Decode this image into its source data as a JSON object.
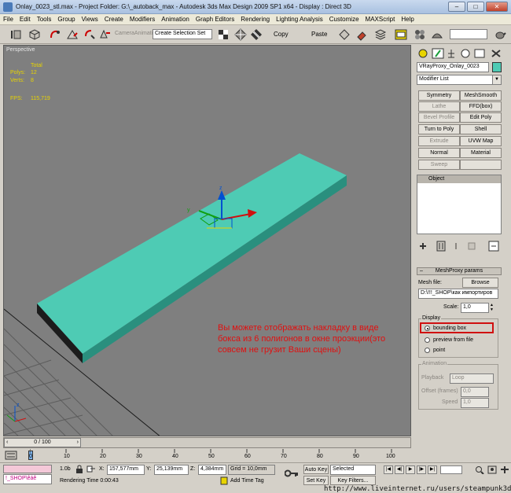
{
  "window": {
    "title": "Onlay_0023_stl.max    - Project Folder: G:\\_autoback_max    - Autodesk 3ds Max Design 2009 SP1  x64      - Display : Direct 3D",
    "minimize": "–",
    "maximize": "□",
    "close": "✕"
  },
  "menu": [
    "File",
    "Edit",
    "Tools",
    "Group",
    "Views",
    "Create",
    "Modifiers",
    "Animation",
    "Graph Editors",
    "Rendering",
    "Lighting Analysis",
    "Customize",
    "MAXScript",
    "Help"
  ],
  "toolbar": {
    "camera_label": "CameraAnimati",
    "selection_set": "Create Selection Set",
    "copy": "Copy",
    "paste": "Paste"
  },
  "viewport": {
    "label": "Perspective",
    "stats": {
      "total_label": "Total",
      "polys_label": "Polys:",
      "polys_value": "12",
      "verts_label": "Verts:",
      "verts_value": "8",
      "fps_label": "FPS:",
      "fps_value": "115,719"
    },
    "annotation": "Вы можете отображать накладку в виде бокса из 6 полигонов в окне проэкции(это совсем не грузит Ваши сцены)",
    "colors": {
      "object": "#4ecbb4",
      "background": "#7f7f7f",
      "annotation": "#e01010"
    }
  },
  "command_panel": {
    "object_name": "VRayProxy_Onlay_0023",
    "object_color": "#4ecbb4",
    "modifier_list": "Modifier List",
    "modifier_buttons": [
      {
        "label": "Symmetry",
        "enabled": true
      },
      {
        "label": "MeshSmooth",
        "enabled": true
      },
      {
        "label": "Lathe",
        "enabled": false
      },
      {
        "label": "FFD(box)",
        "enabled": true
      },
      {
        "label": "Bevel Profile",
        "enabled": false
      },
      {
        "label": "Edit Poly",
        "enabled": true
      },
      {
        "label": "Turn to Poly",
        "enabled": true
      },
      {
        "label": "Shell",
        "enabled": true
      },
      {
        "label": "Extrude",
        "enabled": false
      },
      {
        "label": "UVW Map",
        "enabled": true
      },
      {
        "label": "Normal",
        "enabled": true
      },
      {
        "label": "Material",
        "enabled": true
      },
      {
        "label": "Sweep",
        "enabled": false
      },
      {
        "label": "",
        "enabled": false
      }
    ],
    "stack_item": "Object",
    "rollout_sign": "–",
    "rollout_title": "MeshProxy params",
    "mesh_file_label": "Mesh file:",
    "browse": "Browse",
    "mesh_path": "D:\\!!!_SHOP\\как импортиров",
    "scale_label": "Scale:",
    "scale_value": "1,0",
    "display_group": "Display",
    "display_options": [
      "bounding box",
      "preview from file",
      "point"
    ],
    "display_selected": 0,
    "animation_group": "Animation",
    "playback_label": "Playback",
    "playback_value": "Loop",
    "offset_label": "Offset (frames)",
    "offset_value": "0,0",
    "speed_label": "Speed",
    "speed_value": "1,0"
  },
  "timeline": {
    "slider_label": "0 / 100",
    "ticks": [
      "0",
      "10",
      "20",
      "30",
      "40",
      "50",
      "60",
      "70",
      "80",
      "90",
      "100"
    ]
  },
  "statusbar": {
    "maxscript": "!_SHOP\\êáê",
    "zoom": "1.0b",
    "x_label": "X:",
    "x_value": "157,577mm",
    "y_label": "Y:",
    "y_value": "25,139mm",
    "z_label": "Z:",
    "z_value": "4,384mm",
    "grid": "Grid = 10,0mm",
    "rendering_time": "Rendering Time  0:00:43",
    "add_time_tag": "Add Time Tag",
    "auto_key": "Auto Key",
    "selected": "Selected",
    "set_key": "Set Key",
    "key_filters": "Key Filters...",
    "watermark": "http://www.liveinternet.ru/users/steampunk3d/"
  }
}
